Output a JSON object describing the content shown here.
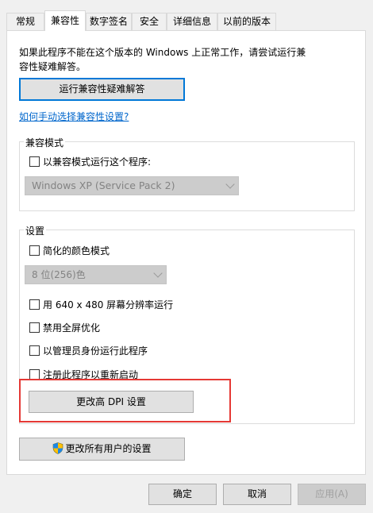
{
  "tabs": [
    {
      "label": "常规"
    },
    {
      "label": "兼容性"
    },
    {
      "label": "数字签名"
    },
    {
      "label": "安全"
    },
    {
      "label": "详细信息"
    },
    {
      "label": "以前的版本"
    }
  ],
  "intro_text_line1": "如果此程序不能在这个版本的 Windows 上正常工作，请尝试运行兼",
  "intro_text_line2": "容性疑难解答。",
  "troubleshooter_button": "运行兼容性疑难解答",
  "manual_link": "如何手动选择兼容性设置?",
  "compat_mode": {
    "legend": "兼容模式",
    "checkbox_label": "以兼容模式运行这个程序:",
    "checked": false,
    "select_value": "Windows XP (Service Pack 2)"
  },
  "settings": {
    "legend": "设置",
    "reduced_color_label": "简化的颜色模式",
    "color_select_value": "8 位(256)色",
    "run_640_label": "用 640 x 480 屏幕分辨率运行",
    "disable_fullscreen_label": "禁用全屏优化",
    "run_as_admin_label": "以管理员身份运行此程序",
    "register_restart_label": "注册此程序以重新启动",
    "dpi_button": "更改高 DPI 设置"
  },
  "all_users_button": "更改所有用户的设置",
  "footer": {
    "ok": "确定",
    "cancel": "取消",
    "apply": "应用(A)"
  },
  "colors": {
    "highlight_box": "#e53935",
    "link": "#0066cc",
    "focus_border": "#0078d7"
  }
}
